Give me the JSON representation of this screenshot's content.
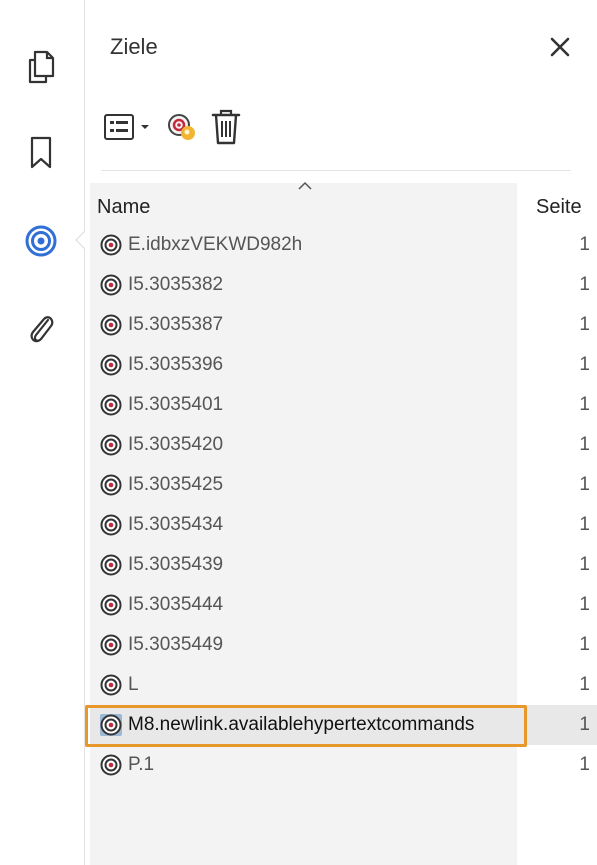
{
  "rail": {
    "items": [
      {
        "icon": "pages-icon"
      },
      {
        "icon": "bookmark-icon"
      },
      {
        "icon": "destinations-icon",
        "active": true
      },
      {
        "icon": "attachment-icon"
      }
    ],
    "accent_color": "#2f6fd6"
  },
  "panel": {
    "title": "Ziele",
    "close_icon": "close-icon"
  },
  "toolbar": {
    "options_icon": "list-options-icon",
    "dropdown_icon": "chevron-down-icon",
    "new_destination_icon": "new-destination-icon",
    "delete_icon": "trash-icon"
  },
  "table": {
    "columns": {
      "name": "Name",
      "page": "Seite"
    },
    "sort_indicator": "caret-up-icon",
    "rows": [
      {
        "name": "E.idbxzVEKWD982h",
        "page": "1"
      },
      {
        "name": "I5.3035382",
        "page": "1"
      },
      {
        "name": "I5.3035387",
        "page": "1"
      },
      {
        "name": "I5.3035396",
        "page": "1"
      },
      {
        "name": "I5.3035401",
        "page": "1"
      },
      {
        "name": "I5.3035420",
        "page": "1"
      },
      {
        "name": "I5.3035425",
        "page": "1"
      },
      {
        "name": "I5.3035434",
        "page": "1"
      },
      {
        "name": "I5.3035439",
        "page": "1"
      },
      {
        "name": "I5.3035444",
        "page": "1"
      },
      {
        "name": "I5.3035449",
        "page": "1"
      },
      {
        "name": "L",
        "page": "1"
      },
      {
        "name": "M8.newlink.availablehypertextcommands",
        "page": "1",
        "selected": true
      },
      {
        "name": "P.1",
        "page": "1"
      }
    ],
    "highlight_color": "#e8972a"
  }
}
